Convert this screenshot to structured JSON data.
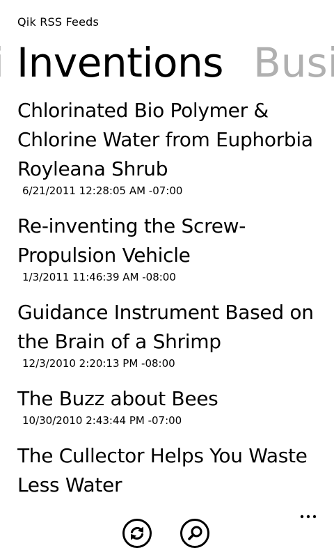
{
  "app": {
    "title": "Qik RSS Feeds"
  },
  "pivot": {
    "prev_header": "i",
    "current_header": "Inventions",
    "next_header": "Busi"
  },
  "feed": {
    "items": [
      {
        "title_lines": [
          "Chlorinated Bio Polymer &",
          "Chlorine Water from Euphorbia",
          "Royleana Shrub"
        ],
        "date": "6/21/2011 12:28:05 AM -07:00"
      },
      {
        "title_lines": [
          "Re-inventing the Screw-",
          "Propulsion Vehicle"
        ],
        "date": "1/3/2011 11:46:39 AM -08:00"
      },
      {
        "title_lines": [
          "Guidance Instrument Based on",
          "the Brain of a Shrimp"
        ],
        "date": "12/3/2010 2:20:13 PM -08:00"
      },
      {
        "title_lines": [
          "The Buzz about Bees"
        ],
        "date": "10/30/2010 2:43:44 PM -07:00"
      },
      {
        "title_lines": [
          "The Cullector Helps You Waste",
          "Less Water"
        ],
        "date": ""
      }
    ]
  },
  "app_bar": {
    "buttons": [
      {
        "icon": "refresh-icon"
      },
      {
        "icon": "search-icon"
      }
    ],
    "more_icon": "ellipsis-icon"
  }
}
